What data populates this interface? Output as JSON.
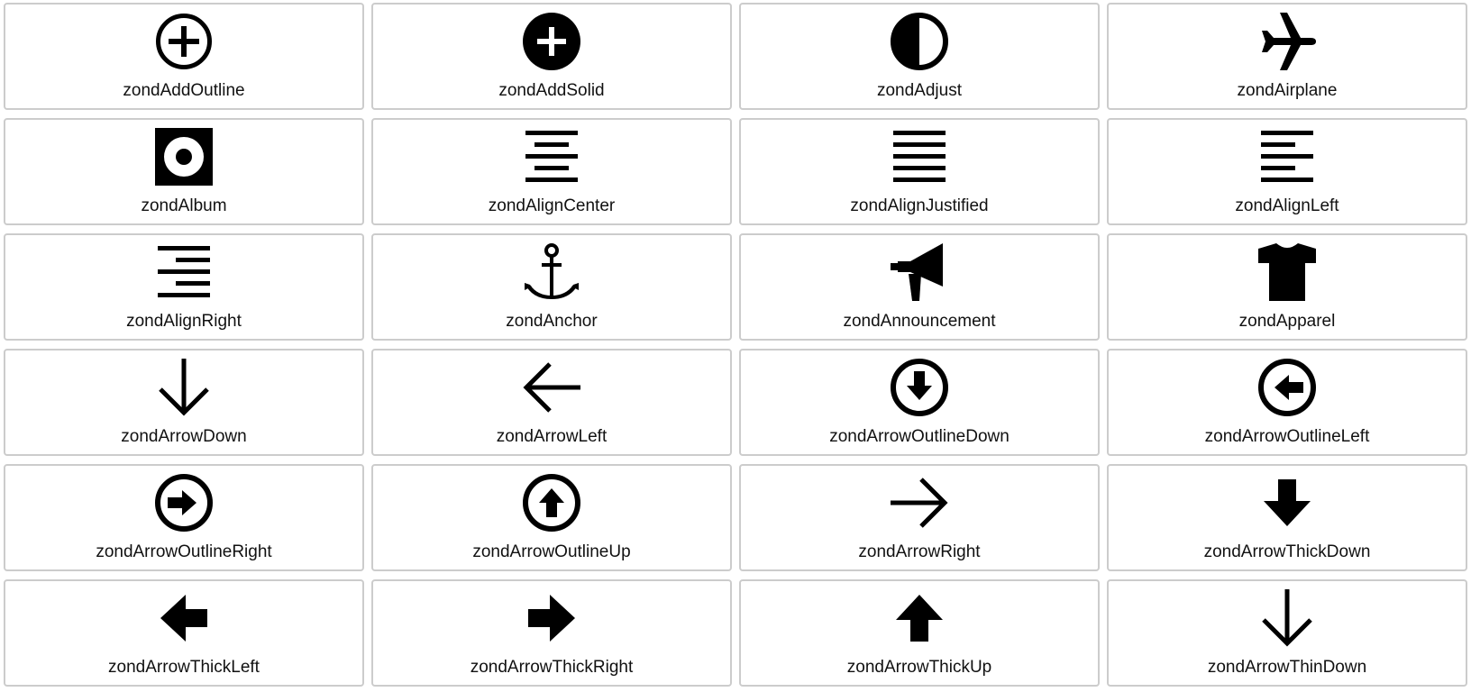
{
  "icons": [
    {
      "name": "zondAddOutline",
      "icon": "add-outline-icon"
    },
    {
      "name": "zondAddSolid",
      "icon": "add-solid-icon"
    },
    {
      "name": "zondAdjust",
      "icon": "adjust-icon"
    },
    {
      "name": "zondAirplane",
      "icon": "airplane-icon"
    },
    {
      "name": "zondAlbum",
      "icon": "album-icon"
    },
    {
      "name": "zondAlignCenter",
      "icon": "align-center-icon"
    },
    {
      "name": "zondAlignJustified",
      "icon": "align-justified-icon"
    },
    {
      "name": "zondAlignLeft",
      "icon": "align-left-icon"
    },
    {
      "name": "zondAlignRight",
      "icon": "align-right-icon"
    },
    {
      "name": "zondAnchor",
      "icon": "anchor-icon"
    },
    {
      "name": "zondAnnouncement",
      "icon": "announcement-icon"
    },
    {
      "name": "zondApparel",
      "icon": "apparel-icon"
    },
    {
      "name": "zondArrowDown",
      "icon": "arrow-down-icon"
    },
    {
      "name": "zondArrowLeft",
      "icon": "arrow-left-icon"
    },
    {
      "name": "zondArrowOutlineDown",
      "icon": "arrow-outline-down-icon"
    },
    {
      "name": "zondArrowOutlineLeft",
      "icon": "arrow-outline-left-icon"
    },
    {
      "name": "zondArrowOutlineRight",
      "icon": "arrow-outline-right-icon"
    },
    {
      "name": "zondArrowOutlineUp",
      "icon": "arrow-outline-up-icon"
    },
    {
      "name": "zondArrowRight",
      "icon": "arrow-right-icon"
    },
    {
      "name": "zondArrowThickDown",
      "icon": "arrow-thick-down-icon"
    },
    {
      "name": "zondArrowThickLeft",
      "icon": "arrow-thick-left-icon"
    },
    {
      "name": "zondArrowThickRight",
      "icon": "arrow-thick-right-icon"
    },
    {
      "name": "zondArrowThickUp",
      "icon": "arrow-thick-up-icon"
    },
    {
      "name": "zondArrowThinDown",
      "icon": "arrow-thin-down-icon"
    }
  ]
}
